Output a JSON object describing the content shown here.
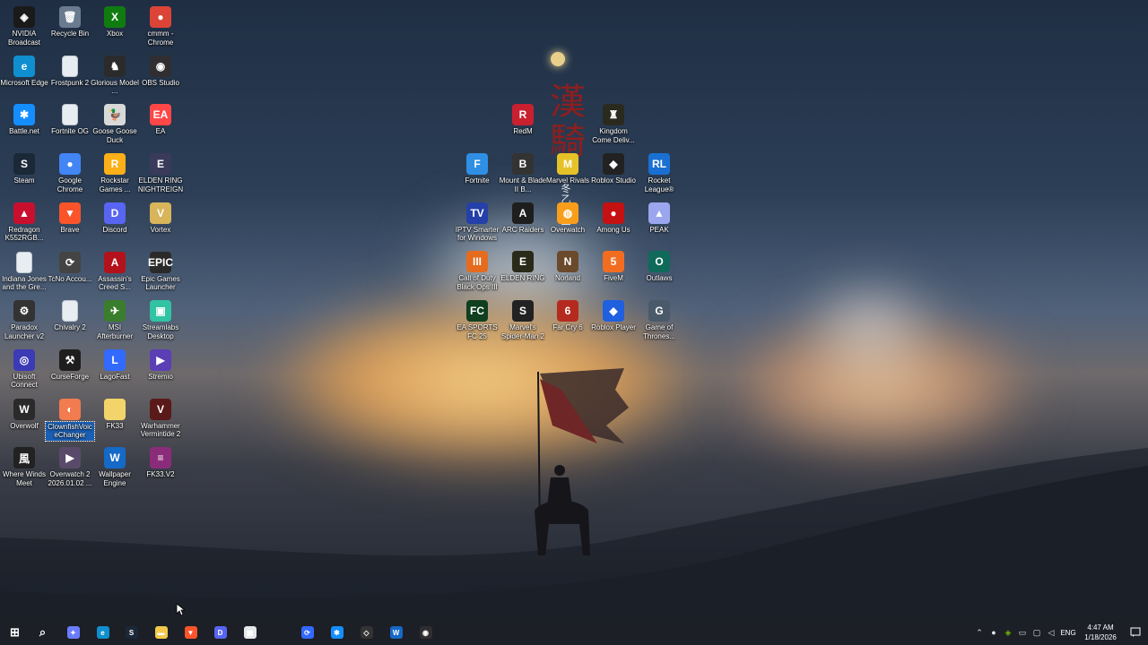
{
  "desktop": {
    "icons": [
      {
        "label": "NVIDIA Broadcast",
        "icon": "nvidia-broadcast-icon",
        "color": "#1a1a1a",
        "glyph": "◈"
      },
      {
        "label": "Recycle Bin",
        "icon": "recycle-bin-icon",
        "color": "#6b7b8f",
        "glyph": "🗑"
      },
      {
        "label": "Xbox",
        "icon": "xbox-icon",
        "color": "#107c10",
        "glyph": "X"
      },
      {
        "label": "cmmm - Chrome",
        "icon": "chrome-icon",
        "color": "#db4437",
        "glyph": "●"
      },
      {
        "label": "Microsoft Edge",
        "icon": "edge-icon",
        "color": "#0f8fcf",
        "glyph": "e"
      },
      {
        "label": "Frostpunk 2",
        "icon": "file-icon",
        "color": "#e8edf2",
        "glyph": ""
      },
      {
        "label": "Glorious Model ...",
        "icon": "glorious-icon",
        "color": "#2b2b2b",
        "glyph": "♞"
      },
      {
        "label": "OBS Studio",
        "icon": "obs-icon",
        "color": "#302e31",
        "glyph": "◉"
      },
      {
        "label": "Battle.net",
        "icon": "battlenet-icon",
        "color": "#148eff",
        "glyph": "✱"
      },
      {
        "label": "Fortnite OG",
        "icon": "file-icon",
        "color": "#e8edf2",
        "glyph": ""
      },
      {
        "label": "Goose Goose Duck",
        "icon": "goose-icon",
        "color": "#d9d9d9",
        "glyph": "🦆"
      },
      {
        "label": "EA",
        "icon": "ea-icon",
        "color": "#ff4747",
        "glyph": "EA"
      },
      {
        "label": "Steam",
        "icon": "steam-icon",
        "color": "#1b2838",
        "glyph": "S"
      },
      {
        "label": "Google Chrome",
        "icon": "chrome-icon",
        "color": "#4285f4",
        "glyph": "●"
      },
      {
        "label": "Rockstar Games ...",
        "icon": "rockstar-icon",
        "color": "#fcaf17",
        "glyph": "R"
      },
      {
        "label": "ELDEN RING NIGHTREIGN",
        "icon": "elden-nightreign-icon",
        "color": "#3a3a5a",
        "glyph": "E"
      },
      {
        "label": "Redragon K552RGB...",
        "icon": "redragon-icon",
        "color": "#c8102e",
        "glyph": "▲"
      },
      {
        "label": "Brave",
        "icon": "brave-icon",
        "color": "#fb542b",
        "glyph": "▼"
      },
      {
        "label": "Discord",
        "icon": "discord-icon",
        "color": "#5865f2",
        "glyph": "D"
      },
      {
        "label": "Vortex",
        "icon": "vortex-icon",
        "color": "#d8b45a",
        "glyph": "V"
      },
      {
        "label": "Indiana Jones and the Gre...",
        "icon": "file-icon",
        "color": "#e8edf2",
        "glyph": ""
      },
      {
        "label": "TcNo Accou...",
        "icon": "tcno-icon",
        "color": "#444",
        "glyph": "⟳"
      },
      {
        "label": "Assassin's Creed S...",
        "icon": "assassins-creed-icon",
        "color": "#b3121b",
        "glyph": "A"
      },
      {
        "label": "Epic Games Launcher",
        "icon": "epic-games-icon",
        "color": "#2a2a2a",
        "glyph": "EPIC"
      },
      {
        "label": "Paradox Launcher v2",
        "icon": "paradox-icon",
        "color": "#333",
        "glyph": "⚙"
      },
      {
        "label": "Chivalry 2",
        "icon": "file-icon",
        "color": "#e8edf2",
        "glyph": ""
      },
      {
        "label": "MSI Afterburner",
        "icon": "msi-afterburner-icon",
        "color": "#3a7d2c",
        "glyph": "✈"
      },
      {
        "label": "Streamlabs Desktop",
        "icon": "streamlabs-icon",
        "color": "#31c3a2",
        "glyph": "▣"
      },
      {
        "label": "Ubisoft Connect",
        "icon": "ubisoft-icon",
        "color": "#3b3bb5",
        "glyph": "◎"
      },
      {
        "label": "CurseForge",
        "icon": "curseforge-icon",
        "color": "#1e1e1e",
        "glyph": "⚒"
      },
      {
        "label": "LagoFast",
        "icon": "lagofast-icon",
        "color": "#3269ff",
        "glyph": "L"
      },
      {
        "label": "Stremio",
        "icon": "stremio-icon",
        "color": "#5b3fb5",
        "glyph": "▶"
      },
      {
        "label": "Overwolf",
        "icon": "overwolf-icon",
        "color": "#2a2a2a",
        "glyph": "W"
      },
      {
        "label": "ClownfishVoiceChanger",
        "icon": "clownfish-icon",
        "color": "#f27b50",
        "glyph": "◐",
        "selected": true
      },
      {
        "label": "FK33",
        "icon": "folder-icon",
        "color": "#f2d46b",
        "glyph": ""
      },
      {
        "label": "Warhammer Vermintide 2",
        "icon": "vermintide-icon",
        "color": "#5a1a1a",
        "glyph": "V"
      },
      {
        "label": "Where Winds Meet",
        "icon": "where-winds-meet-icon",
        "color": "#222",
        "glyph": "風"
      },
      {
        "label": "Overwatch 2 2026.01.02 ...",
        "icon": "video-icon",
        "color": "#5a4a6a",
        "glyph": "▶"
      },
      {
        "label": "Wallpaper Engine",
        "icon": "wallpaper-engine-icon",
        "color": "#1569c7",
        "glyph": "W"
      },
      {
        "label": "FK33.V2",
        "icon": "winrar-icon",
        "color": "#8b2c7a",
        "glyph": "≡"
      },
      {
        "label": "RedM",
        "icon": "redm-icon",
        "color": "#c8202f",
        "glyph": "R"
      },
      {
        "label": "Kingdom Come Deliv...",
        "icon": "kingdom-come-icon",
        "color": "#2a2a1e",
        "glyph": "♜"
      },
      {
        "label": "Fortnite",
        "icon": "fortnite-icon",
        "color": "#2f8fe4",
        "glyph": "F"
      },
      {
        "label": "Mount & Blade II B...",
        "icon": "bannerlord-icon",
        "color": "#333",
        "glyph": "B"
      },
      {
        "label": "Marvel Rivals",
        "icon": "marvel-rivals-icon",
        "color": "#e6c229",
        "glyph": "M"
      },
      {
        "label": "Roblox Studio",
        "icon": "roblox-studio-icon",
        "color": "#222",
        "glyph": "◆"
      },
      {
        "label": "Rocket League®",
        "icon": "rocket-league-icon",
        "color": "#1a6fd3",
        "glyph": "RL"
      },
      {
        "label": "IPTV Smarter for Windows",
        "icon": "iptv-icon",
        "color": "#2540a8",
        "glyph": "TV"
      },
      {
        "label": "ARC Raiders",
        "icon": "arc-raiders-icon",
        "color": "#1e1e1e",
        "glyph": "A"
      },
      {
        "label": "Overwatch",
        "icon": "overwatch-icon",
        "color": "#f99e1a",
        "glyph": "◍"
      },
      {
        "label": "Among Us",
        "icon": "among-us-icon",
        "color": "#c51111",
        "glyph": "●"
      },
      {
        "label": "PEAK",
        "icon": "peak-icon",
        "color": "#9aa7ee",
        "glyph": "▲"
      },
      {
        "label": "Call of Duty Black Ops III",
        "icon": "cod-icon",
        "color": "#e56b1f",
        "glyph": "III"
      },
      {
        "label": "ELDEN RING",
        "icon": "elden-ring-icon",
        "color": "#2a2a1a",
        "glyph": "E"
      },
      {
        "label": "Norland",
        "icon": "norland-icon",
        "color": "#6b4a2c",
        "glyph": "N"
      },
      {
        "label": "FiveM",
        "icon": "fivem-icon",
        "color": "#f36d21",
        "glyph": "5"
      },
      {
        "label": "Outlaws",
        "icon": "outlaws-icon",
        "color": "#0f6a5a",
        "glyph": "O"
      },
      {
        "label": "EA SPORTS FC 25",
        "icon": "ea-fc-icon",
        "color": "#0f3f1f",
        "glyph": "FC"
      },
      {
        "label": "Marvel's Spider-Man 2",
        "icon": "spiderman-icon",
        "color": "#222",
        "glyph": "S"
      },
      {
        "label": "Far Cry 6",
        "icon": "far-cry-icon",
        "color": "#b52a1f",
        "glyph": "6"
      },
      {
        "label": "Roblox Player",
        "icon": "roblox-icon",
        "color": "#1f5fe0",
        "glyph": "◆"
      },
      {
        "label": "Game of Thrones...",
        "icon": "game-of-thrones-icon",
        "color": "#4a5a6a",
        "glyph": "G"
      }
    ]
  },
  "wallpaper": {
    "kanji": "漢\n騎",
    "kanji_small": "冬\n乙\n月\n王"
  },
  "taskbar": {
    "apps": [
      {
        "name": "start-button",
        "icon": "windows-icon",
        "color": "#3aa0ff",
        "glyph": "⊞"
      },
      {
        "name": "search-button",
        "icon": "search-icon",
        "color": "#dfe3ea",
        "glyph": "⌕"
      },
      {
        "name": "taskbar-copilot",
        "icon": "copilot-icon",
        "color": "#6a7cff",
        "glyph": "✦"
      },
      {
        "name": "taskbar-edge",
        "icon": "edge-icon",
        "color": "#0f8fcf",
        "glyph": "e"
      },
      {
        "name": "taskbar-steam",
        "icon": "steam-icon",
        "color": "#1b2838",
        "glyph": "S"
      },
      {
        "name": "taskbar-file-explorer",
        "icon": "folder-icon",
        "color": "#f2c94c",
        "glyph": "▬"
      },
      {
        "name": "taskbar-brave",
        "icon": "brave-icon",
        "color": "#fb542b",
        "glyph": "▼"
      },
      {
        "name": "taskbar-discord",
        "icon": "discord-icon",
        "color": "#5865f2",
        "glyph": "D"
      },
      {
        "name": "taskbar-store",
        "icon": "store-icon",
        "color": "#e5e7ea",
        "glyph": "▦"
      },
      {
        "name": "taskbar-app-1",
        "icon": "lagofast-icon",
        "color": "#3269ff",
        "glyph": "⟳"
      },
      {
        "name": "taskbar-battlenet",
        "icon": "battlenet-icon",
        "color": "#148eff",
        "glyph": "✱"
      },
      {
        "name": "taskbar-epic",
        "icon": "epic-games-icon",
        "color": "#333",
        "glyph": "◇"
      },
      {
        "name": "taskbar-app-2",
        "icon": "wallpaper-engine-icon",
        "color": "#1569c7",
        "glyph": "W"
      },
      {
        "name": "taskbar-obs",
        "icon": "obs-icon",
        "color": "#302e31",
        "glyph": "◉"
      }
    ],
    "tray": {
      "language": "ENG",
      "time": "4:47 AM",
      "date": "1/18/2026"
    }
  }
}
